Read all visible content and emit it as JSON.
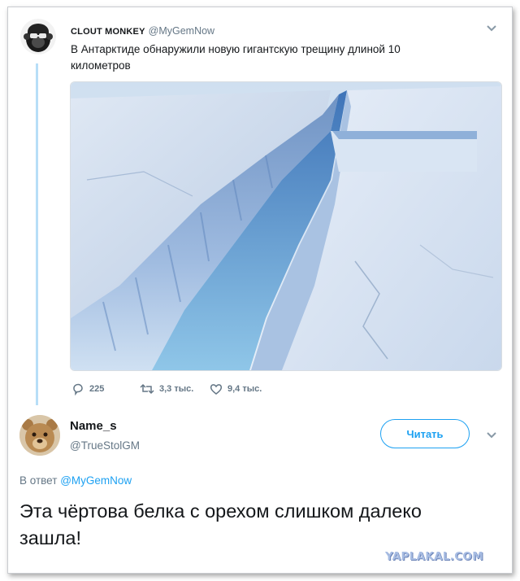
{
  "tweet1": {
    "display_name": "CLOUT MONKEY",
    "handle": "@MyGemNow",
    "text": "В Антарктиде обнаружили новую гигантскую трещину длиной 10 километров",
    "stats": {
      "replies": "225",
      "retweets": "3,3 тыс.",
      "likes": "9,4 тыс."
    }
  },
  "tweet2": {
    "display_name": "Name_s",
    "handle": "@TrueStolGM",
    "follow_label": "Читать",
    "reply_prefix": "В ответ",
    "reply_to": "@MyGemNow",
    "text": "Эта чёртова белка с орехом слишком далеко зашла!"
  },
  "watermark": "YAPLAKAL.COM",
  "colors": {
    "accent": "#1da1f2",
    "muted": "#657786",
    "thread": "#b7def7"
  },
  "icons": [
    "reply-icon",
    "retweet-icon",
    "like-icon",
    "chevron-down-icon"
  ]
}
